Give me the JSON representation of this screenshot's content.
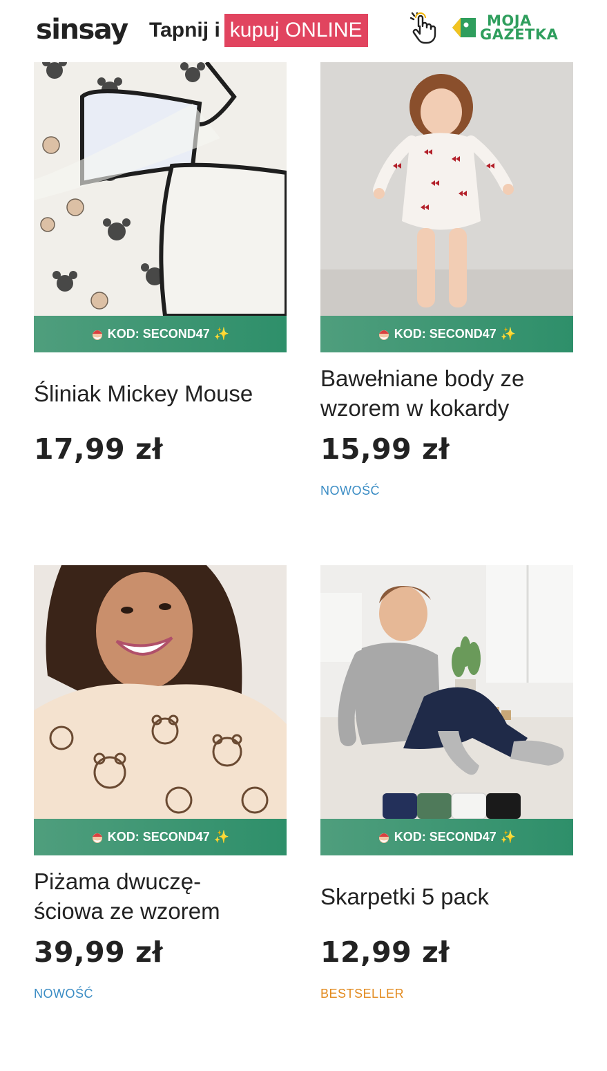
{
  "header": {
    "logo_text": "sinsay",
    "tagline_plain": "Tapnij i",
    "tagline_highlight": "kupuj ONLINE",
    "hand_icon": "pointing-hand-icon",
    "partner_logo_line1": "MOJA",
    "partner_logo_line2": "GAZETKA",
    "accent_color": "#e1445f",
    "partner_color": "#2f9e5d"
  },
  "products": [
    {
      "title": "Śliniak Mickey Mouse",
      "promo": "KOD: SECOND47",
      "price": "17,99 zł",
      "badge": ""
    },
    {
      "title": "Bawełniane body ze wzorem w kokardy",
      "promo": "KOD: SECOND47",
      "price": "15,99 zł",
      "badge": "NOWOŚĆ"
    },
    {
      "title": "Piżama dwuczę-ściowa ze wzorem",
      "promo": "KOD: SECOND47",
      "price": "39,99 zł",
      "badge": "NOWOŚĆ"
    },
    {
      "title": "Skarpetki 5 pack",
      "promo": "KOD: SECOND47",
      "price": "12,99 zł",
      "badge": "BESTSELLER"
    }
  ],
  "colors": {
    "promo_bar": "#3f977a",
    "badge_new": "#3a8cc4",
    "badge_bestseller": "#e28a1e"
  }
}
